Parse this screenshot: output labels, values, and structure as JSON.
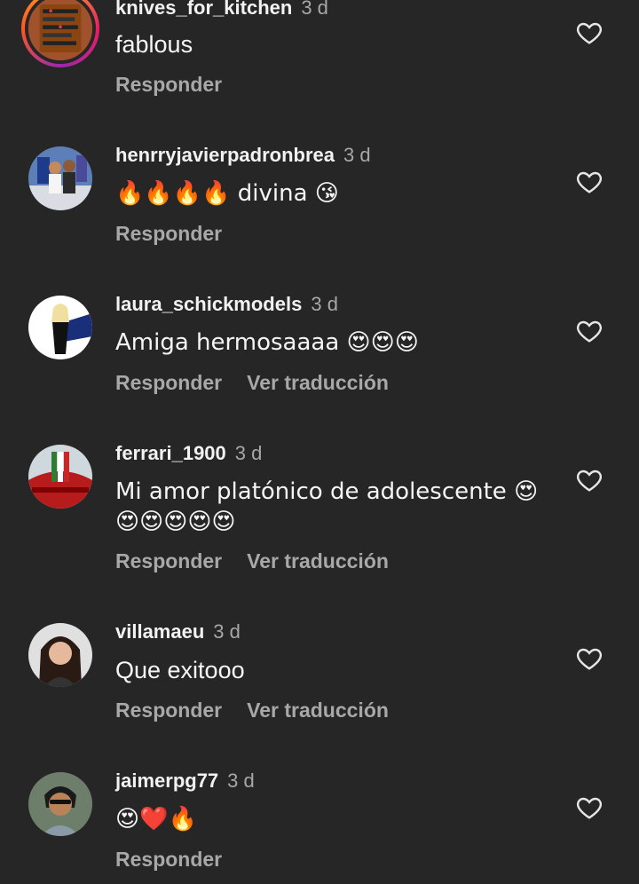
{
  "comments": [
    {
      "username": "knives_for_kitchen",
      "time": "3 d",
      "text": "fablous",
      "reply_label": "Responder",
      "translate_label": ""
    },
    {
      "username": "henrryjavierpadronbrea",
      "time": "3 d",
      "text": "🔥🔥🔥🔥 divina 😘",
      "reply_label": "Responder",
      "translate_label": ""
    },
    {
      "username": "laura_schickmodels",
      "time": "3 d",
      "text": "Amiga hermosaaaa 😍😍😍",
      "reply_label": "Responder",
      "translate_label": "Ver traducción"
    },
    {
      "username": "ferrari_1900",
      "time": "3 d",
      "text": "Mi amor platónico de adolescente 😍 😍😍😍😍😍",
      "reply_label": "Responder",
      "translate_label": "Ver traducción"
    },
    {
      "username": "villamaeu",
      "time": "3 d",
      "text": "Que exitooo",
      "reply_label": "Responder",
      "translate_label": "Ver traducción"
    },
    {
      "username": "jaimerpg77",
      "time": "3 d",
      "text": "😍❤️🔥",
      "reply_label": "Responder",
      "translate_label": ""
    }
  ],
  "icons": {
    "like": "heart-outline-icon"
  },
  "colors": {
    "background": "#262626",
    "secondary_text": "#a8a8a8",
    "primary_text": "#f5f5f5"
  }
}
